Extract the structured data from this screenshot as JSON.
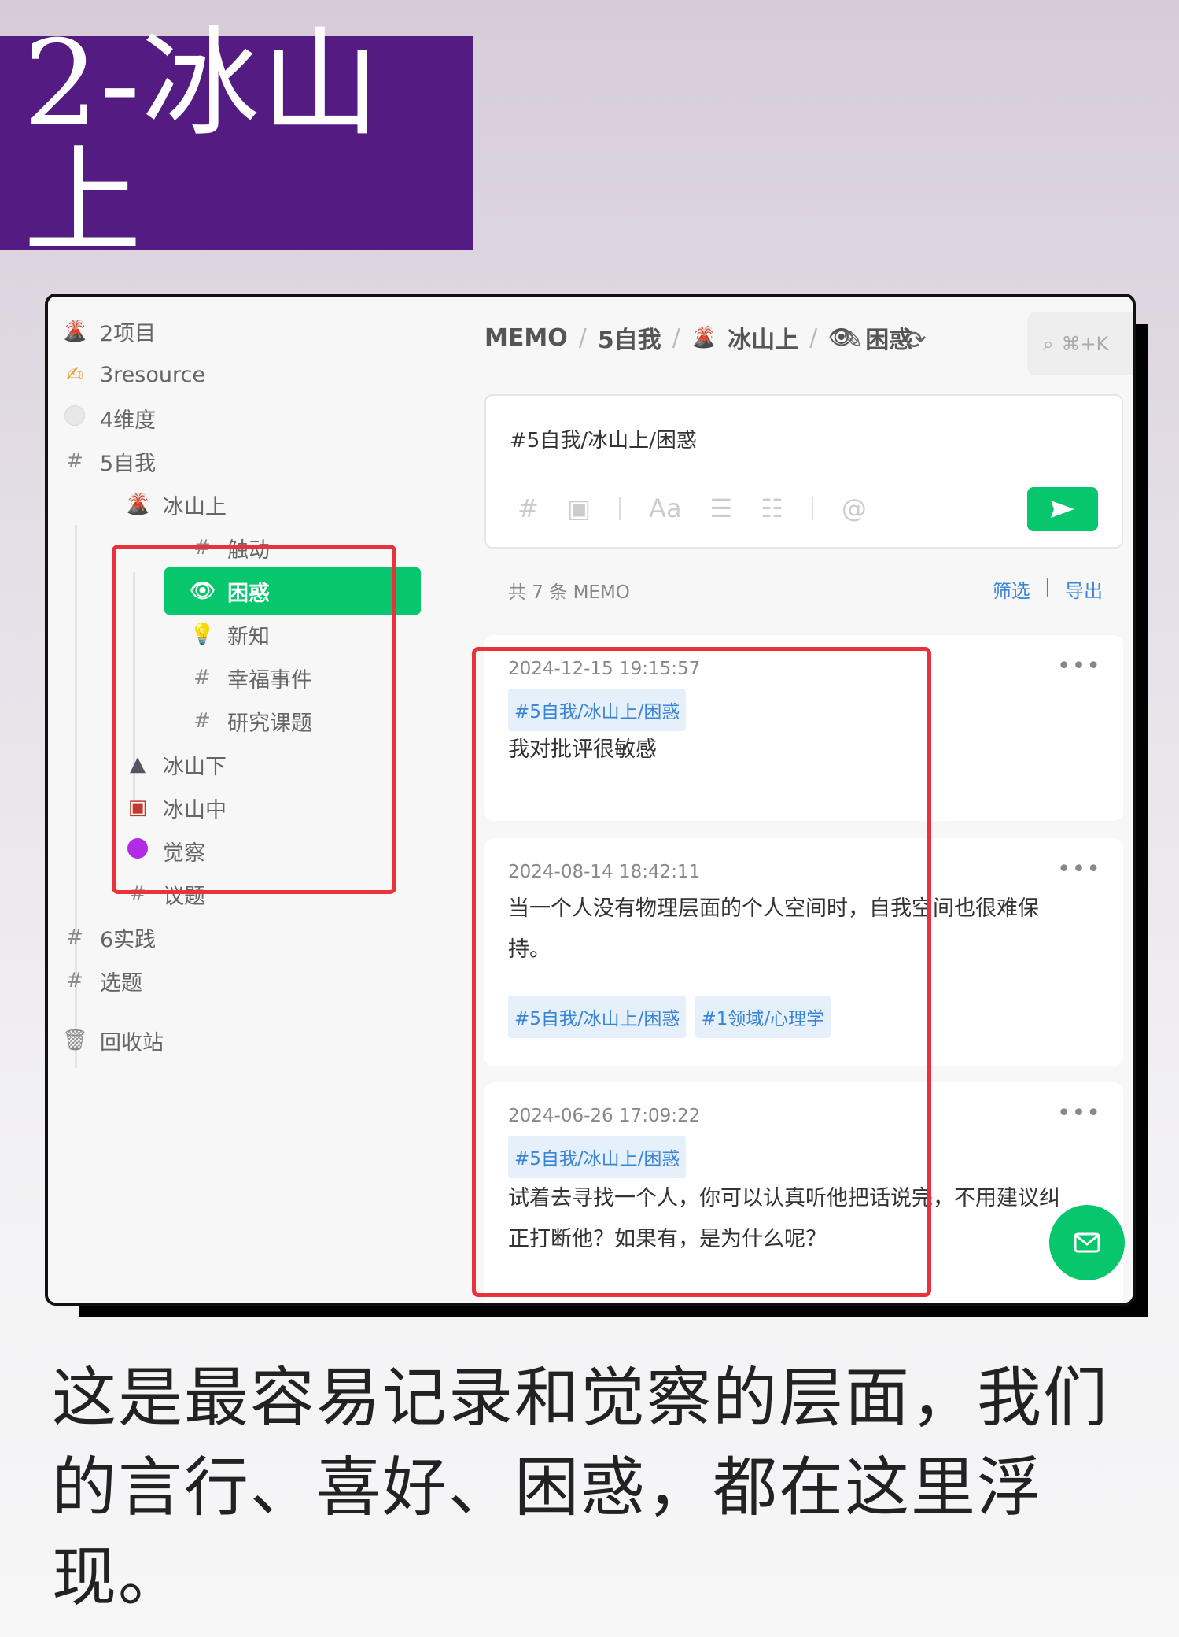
{
  "banner": {
    "title": "2-冰山上"
  },
  "sidebar": {
    "items": [
      {
        "icon": "volcano-icon",
        "glyph": "🌋",
        "label": "2项目"
      },
      {
        "icon": "writing-hand-icon",
        "glyph": "✍",
        "label": "3resource"
      },
      {
        "icon": "white-circle-icon",
        "glyph": "",
        "label": "4维度"
      },
      {
        "icon": "hash-icon",
        "glyph": "#",
        "label": "5自我"
      },
      {
        "icon": "volcano-icon",
        "glyph": "🌋",
        "label": "冰山上"
      },
      {
        "icon": "hash-icon",
        "glyph": "#",
        "label": "触动"
      },
      {
        "icon": "eye-icon",
        "glyph": "👁",
        "label": "困惑"
      },
      {
        "icon": "idea-icon",
        "glyph": "💡",
        "label": "新知"
      },
      {
        "icon": "hash-icon",
        "glyph": "#",
        "label": "幸福事件"
      },
      {
        "icon": "hash-icon",
        "glyph": "#",
        "label": "研究课题"
      },
      {
        "icon": "mountain-icon",
        "glyph": "▲",
        "label": "冰山下"
      },
      {
        "icon": "sunset-icon",
        "glyph": "▣",
        "label": "冰山中"
      },
      {
        "icon": "purple-circle-icon",
        "glyph": "",
        "label": "觉察"
      },
      {
        "icon": "hash-icon",
        "glyph": "#",
        "label": "议题"
      },
      {
        "icon": "hash-icon",
        "glyph": "#",
        "label": "6实践"
      },
      {
        "icon": "hash-icon",
        "glyph": "#",
        "label": "选题"
      },
      {
        "icon": "trash-icon",
        "glyph": "🗑",
        "label": "回收站"
      }
    ]
  },
  "header": {
    "crumbs": [
      "MEMO",
      "5自我",
      "冰山上",
      "困惑"
    ],
    "separator": "/",
    "search_shortcut": "⌘+K"
  },
  "editor": {
    "content": "#5自我/冰山上/困惑",
    "tools": [
      "#",
      "▣",
      "Aa",
      "☰",
      "☷",
      "@"
    ]
  },
  "list": {
    "count_label": "共 7 条 MEMO",
    "filter_label": "筛选",
    "separator": "|",
    "export_label": "导出"
  },
  "memos": [
    {
      "timestamp": "2024-12-15 19:15:57",
      "tags": [
        "#5自我/冰山上/困惑"
      ],
      "text": "我对批评很敏感"
    },
    {
      "timestamp": "2024-08-14 18:42:11",
      "tags": [
        "#5自我/冰山上/困惑",
        "#1领域/心理学"
      ],
      "text": "当一个人没有物理层面的个人空间时，自我空间也很难保持。"
    },
    {
      "timestamp": "2024-06-26 17:09:22",
      "tags": [
        "#5自我/冰山上/困惑"
      ],
      "text": "试着去寻找一个人，你可以认真听他把话说完，不用建议纠正打断他？如果有，是为什么呢？"
    }
  ],
  "more_glyph": "•••",
  "caption": "这是最容易记录和觉察的层面，我们的言行、喜好、困惑，都在这里浮现。",
  "colors": {
    "accent": "#07c66c",
    "banner": "#541b82",
    "highlight": "#e8333c",
    "tag_text": "#3a84d6"
  }
}
